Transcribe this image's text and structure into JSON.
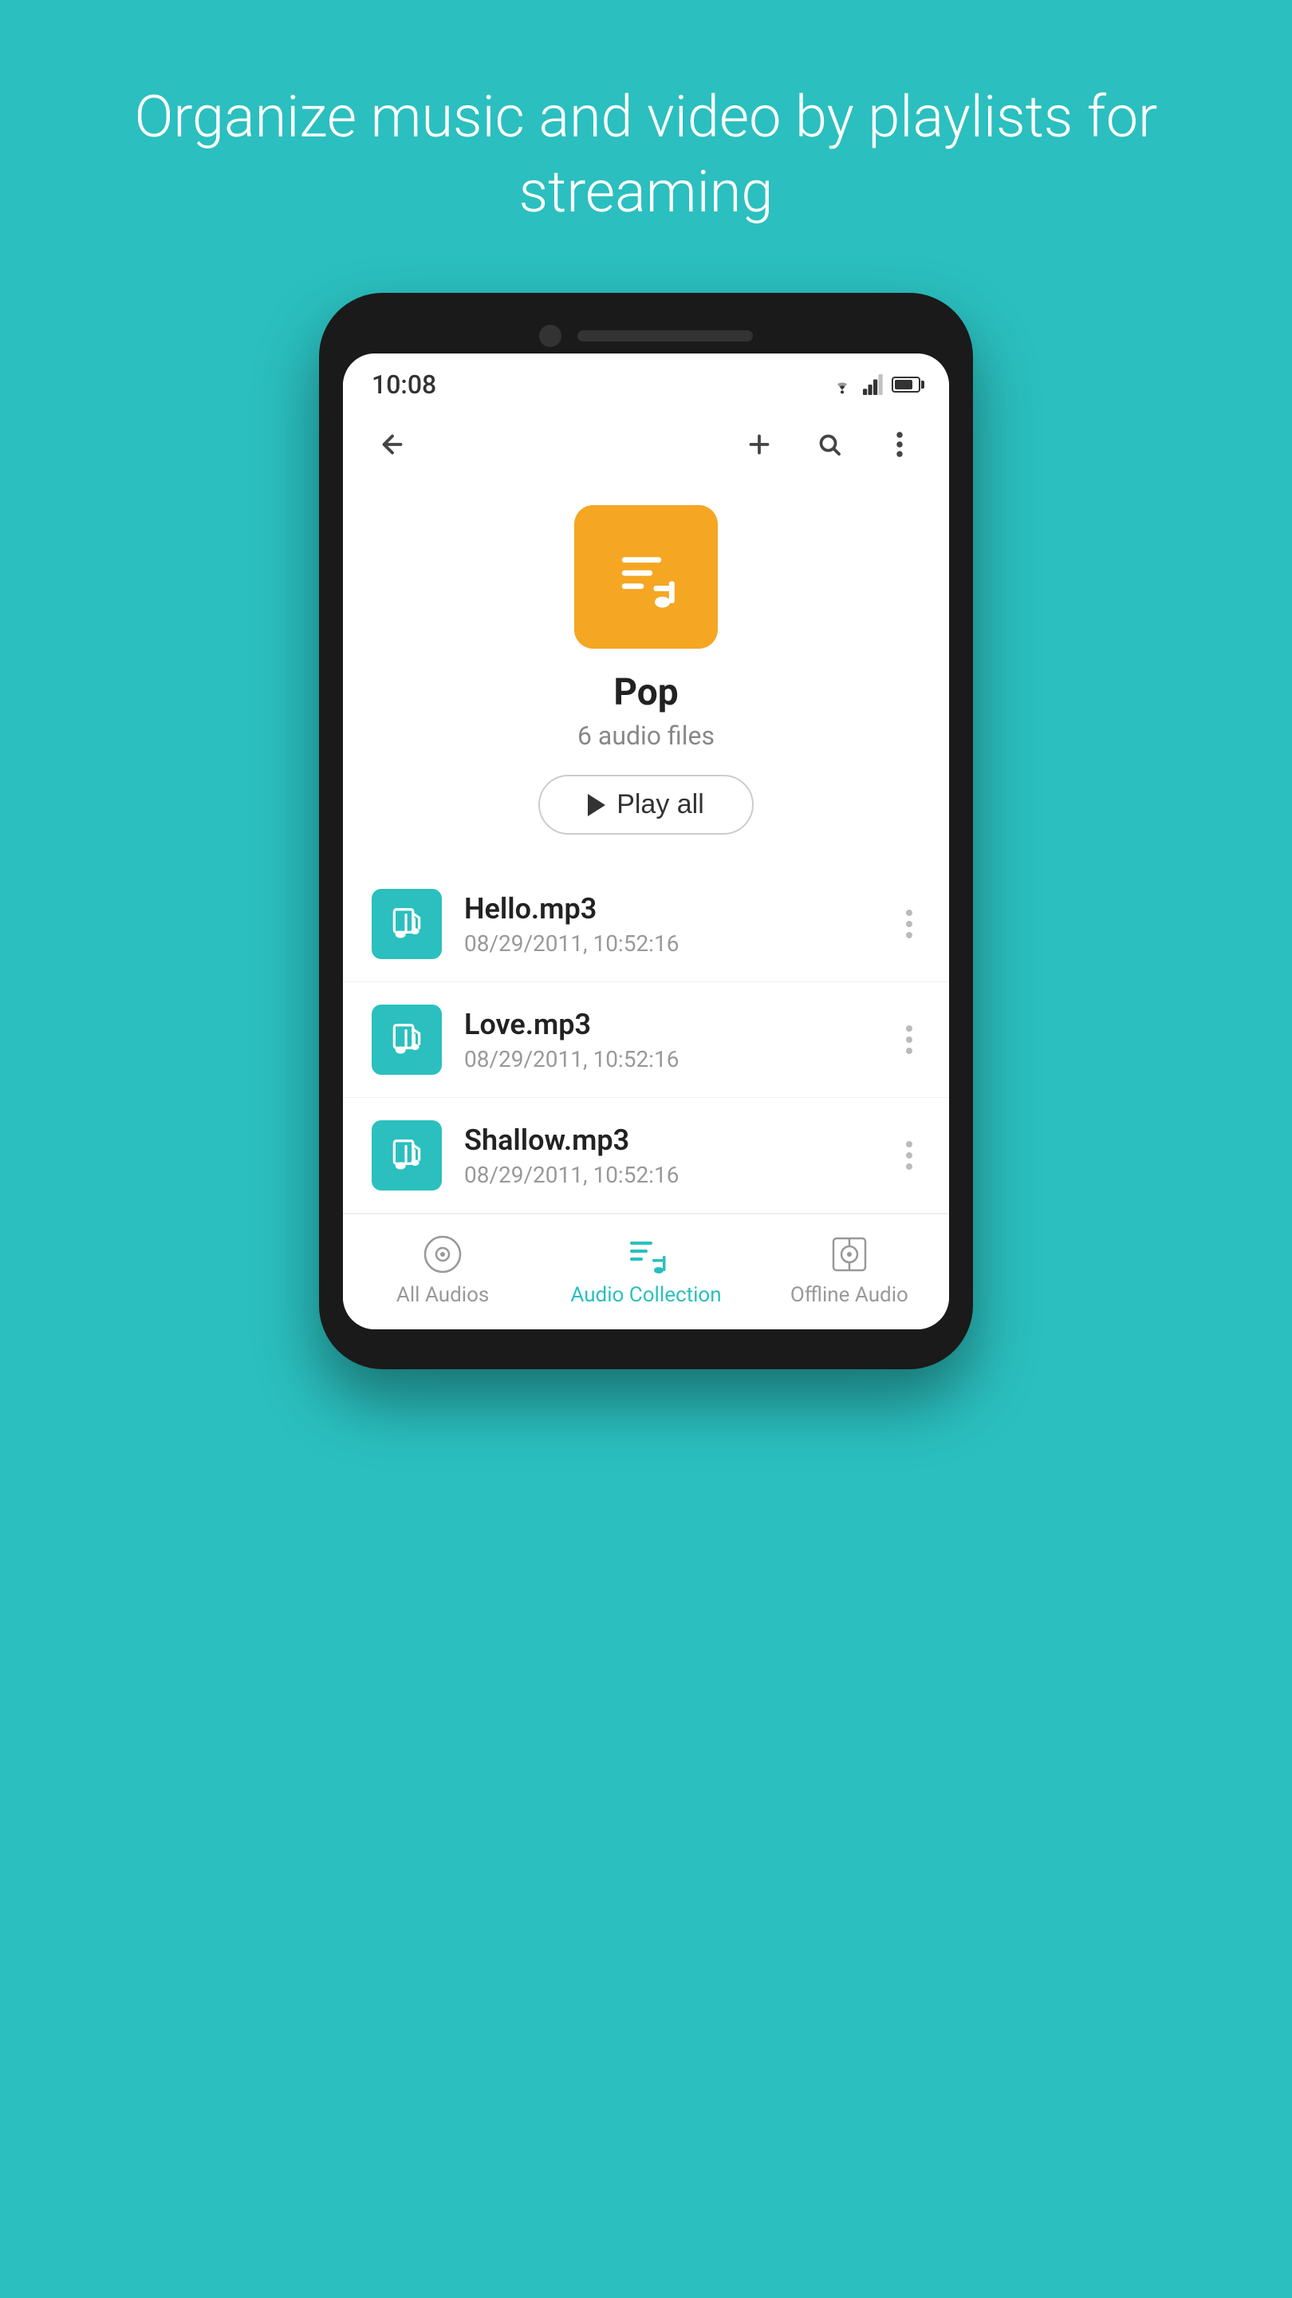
{
  "hero": {
    "title": "Organize music and video by playlists for streaming"
  },
  "status_bar": {
    "time": "10:08"
  },
  "app_bar": {
    "back_label": "back",
    "add_label": "add",
    "search_label": "search",
    "more_label": "more"
  },
  "playlist": {
    "name": "Pop",
    "count": "6 audio files",
    "play_all_label": "Play all"
  },
  "audio_files": [
    {
      "name": "Hello.mp3",
      "date": "08/29/2011, 10:52:16"
    },
    {
      "name": "Love.mp3",
      "date": "08/29/2011, 10:52:16"
    },
    {
      "name": "Shallow.mp3",
      "date": "08/29/2011, 10:52:16"
    }
  ],
  "bottom_nav": {
    "items": [
      {
        "id": "all-audios",
        "label": "All Audios",
        "active": false
      },
      {
        "id": "audio-collection",
        "label": "Audio Collection",
        "active": true
      },
      {
        "id": "offline-audio",
        "label": "Offline Audio",
        "active": false
      }
    ]
  }
}
